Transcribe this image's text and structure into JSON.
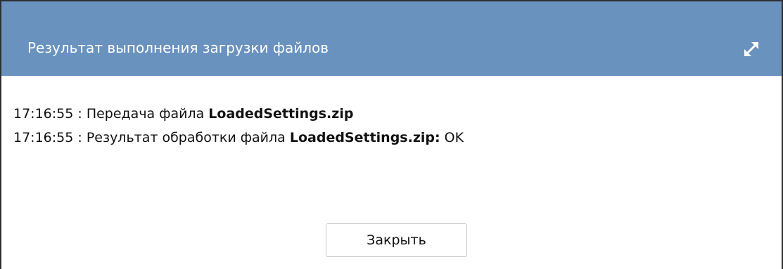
{
  "dialog": {
    "title": "Результат выполнения загрузки файлов",
    "expand_icon": "expand-diagonal-arrows-icon",
    "header_color": "#6a92bf"
  },
  "log": [
    {
      "prefix": "17:16:55 : Передача файла ",
      "file": "LoadedSettings.zip",
      "suffix": ""
    },
    {
      "prefix": "17:16:55 : Результат обработки файла ",
      "file": "LoadedSettings.zip:",
      "suffix": " OK"
    }
  ],
  "buttons": {
    "close_label": "Закрыть"
  }
}
